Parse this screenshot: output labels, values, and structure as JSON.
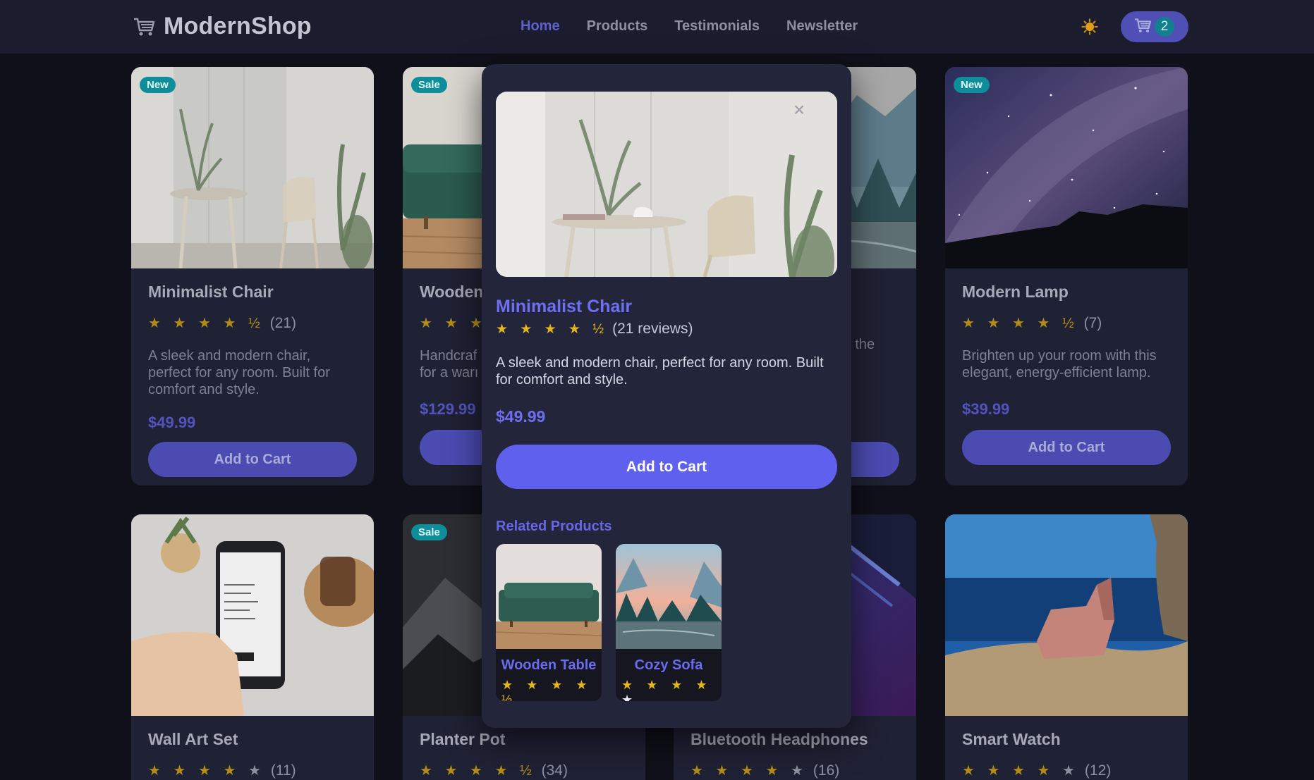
{
  "header": {
    "brand": "ModernShop",
    "nav": [
      "Home",
      "Products",
      "Testimonials",
      "Newsletter"
    ],
    "active_nav": "Home",
    "cart_count": "2",
    "icons": [
      "shopping-cart-icon",
      "sun-icon"
    ]
  },
  "products": [
    {
      "name": "Minimalist Chair",
      "badge": "New",
      "stars": "★ ★ ★ ★ ½",
      "rating": 4.5,
      "count": "(21)",
      "description": "A sleek and modern chair, perfect for any room. Built for comfort and style.",
      "price": "$49.99",
      "button": "Add to Cart"
    },
    {
      "name": "Wooden",
      "badge": "Sale",
      "stars": "★ ★ ★",
      "count": "",
      "description": "Handcraf\nfor a warı",
      "price": "$129.99",
      "button": "Add to Cart"
    },
    {
      "name": "",
      "badge": "",
      "stars": "",
      "count": "",
      "description": "g – the\ng",
      "price": "",
      "button": ""
    },
    {
      "name": "Modern Lamp",
      "badge": "New",
      "stars": "★ ★ ★ ★ ½",
      "rating": 4.5,
      "count": "(7)",
      "description": "Brighten up your room with this elegant, energy-efficient lamp.",
      "price": "$39.99",
      "button": "Add to Cart"
    },
    {
      "name": "Wall Art Set",
      "badge": "",
      "stars": "★ ★ ★ ★ ★",
      "rating": 4,
      "count": "(11)",
      "description": "",
      "price": "",
      "button": ""
    },
    {
      "name": "Planter Pot",
      "badge": "Sale",
      "stars": "★ ★ ★ ★ ½",
      "rating": 4.5,
      "count": "(34)",
      "description": "",
      "price": "",
      "button": ""
    },
    {
      "name": "Bluetooth Headphones",
      "badge": "",
      "stars": "★ ★ ★ ★ ★",
      "rating": 4,
      "count": "(16)",
      "description": "",
      "price": "",
      "button": ""
    },
    {
      "name": "Smart Watch",
      "badge": "",
      "stars": "★ ★ ★ ★ ★",
      "rating": 4,
      "count": "(12)",
      "description": "",
      "price": "",
      "button": ""
    }
  ],
  "modal": {
    "title": "Minimalist Chair",
    "stars": "★ ★ ★ ★ ½",
    "rating": 4.5,
    "reviews": "(21 reviews)",
    "description": "A sleek and modern chair, perfect for any room. Built for comfort and style.",
    "price": "$49.99",
    "button": "Add to Cart",
    "close": "×",
    "related_title": "Related Products",
    "related": [
      {
        "name": "Wooden Table",
        "stars": "★ ★ ★ ★ ½",
        "rating": 4.5
      },
      {
        "name": "Cozy Sofa",
        "stars_filled": "★ ★ ★ ★",
        "stars_empty": "★",
        "rating": 4
      }
    ]
  },
  "colors": {
    "accent": "#6060ef",
    "background": "#0f1019",
    "surface": "#1f2134",
    "badge": "#0e8d9a",
    "star": "#e4b51c"
  }
}
